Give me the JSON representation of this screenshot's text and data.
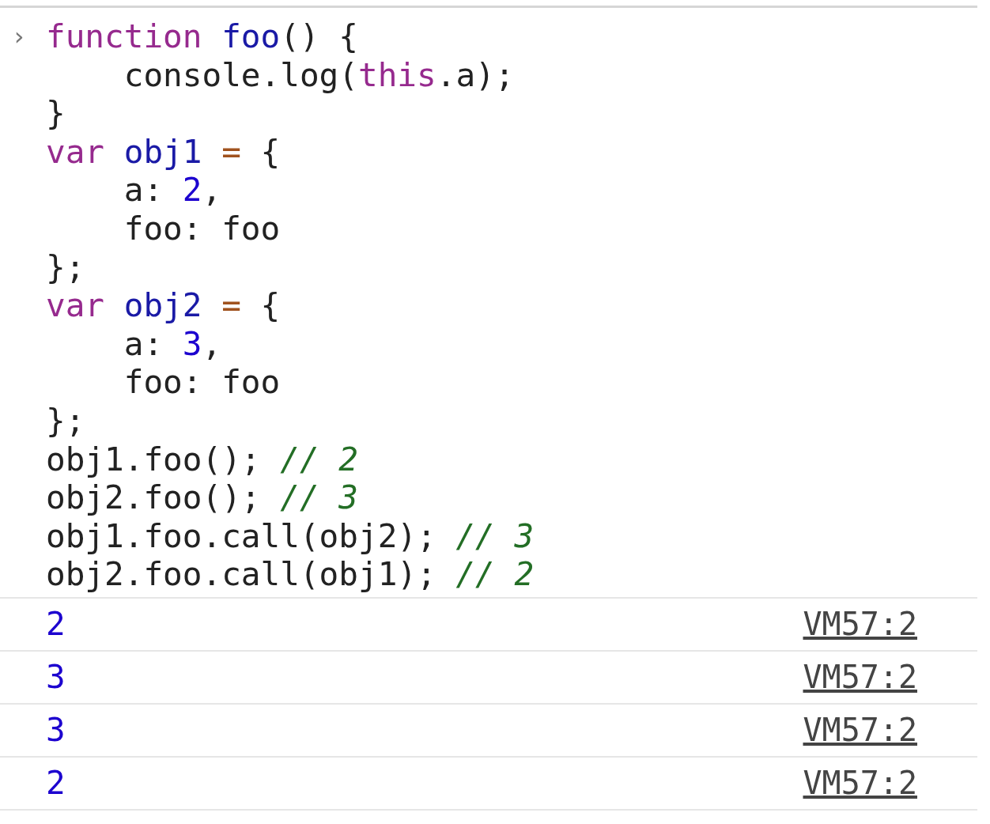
{
  "input": {
    "prompt": "›",
    "lines": [
      [
        {
          "kind": "keyword",
          "text": "function"
        },
        {
          "kind": "name",
          "text": " foo"
        },
        {
          "kind": "plain",
          "text": "() {"
        }
      ],
      [
        {
          "kind": "plain",
          "text": "    console.log("
        },
        {
          "kind": "keyword",
          "text": "this"
        },
        {
          "kind": "plain",
          "text": ".a);"
        }
      ],
      [
        {
          "kind": "plain",
          "text": "}"
        }
      ],
      [
        {
          "kind": "keyword",
          "text": "var"
        },
        {
          "kind": "name",
          "text": " obj1"
        },
        {
          "kind": "operator",
          "text": " ="
        },
        {
          "kind": "plain",
          "text": " {"
        }
      ],
      [
        {
          "kind": "plain",
          "text": "    a: "
        },
        {
          "kind": "number",
          "text": "2"
        },
        {
          "kind": "plain",
          "text": ","
        }
      ],
      [
        {
          "kind": "plain",
          "text": "    foo: foo"
        }
      ],
      [
        {
          "kind": "plain",
          "text": "};"
        }
      ],
      [
        {
          "kind": "keyword",
          "text": "var"
        },
        {
          "kind": "name",
          "text": " obj2"
        },
        {
          "kind": "operator",
          "text": " ="
        },
        {
          "kind": "plain",
          "text": " {"
        }
      ],
      [
        {
          "kind": "plain",
          "text": "    a: "
        },
        {
          "kind": "number",
          "text": "3"
        },
        {
          "kind": "plain",
          "text": ","
        }
      ],
      [
        {
          "kind": "plain",
          "text": "    foo: foo"
        }
      ],
      [
        {
          "kind": "plain",
          "text": "};"
        }
      ],
      [
        {
          "kind": "plain",
          "text": "obj1.foo(); "
        },
        {
          "kind": "comment",
          "text": "// 2"
        }
      ],
      [
        {
          "kind": "plain",
          "text": "obj2.foo(); "
        },
        {
          "kind": "comment",
          "text": "// 3"
        }
      ],
      [
        {
          "kind": "plain",
          "text": "obj1.foo.call(obj2); "
        },
        {
          "kind": "comment",
          "text": "// 3"
        }
      ],
      [
        {
          "kind": "plain",
          "text": "obj2.foo.call(obj1); "
        },
        {
          "kind": "comment",
          "text": "// 2"
        }
      ]
    ]
  },
  "output": [
    {
      "value": "2",
      "source": "VM57:2"
    },
    {
      "value": "3",
      "source": "VM57:2"
    },
    {
      "value": "3",
      "source": "VM57:2"
    },
    {
      "value": "2",
      "source": "VM57:2"
    }
  ]
}
